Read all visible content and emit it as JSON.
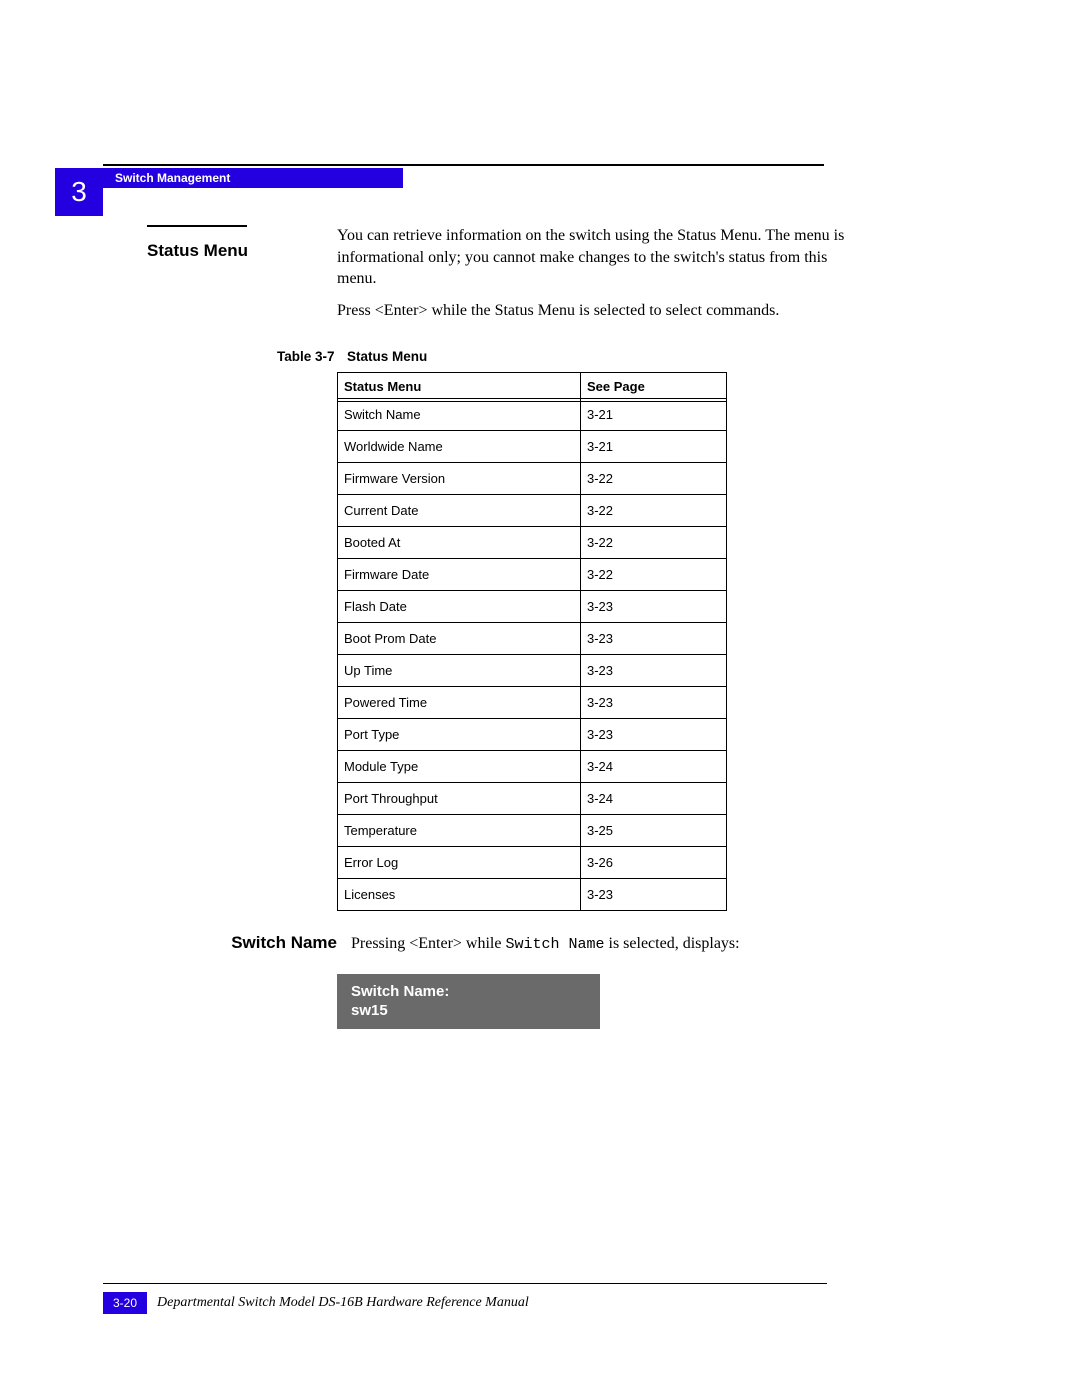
{
  "chapter_number": "3",
  "header_title": "Switch Management",
  "section": {
    "title": "Status Menu",
    "paragraph1": "You can retrieve information on the switch using the Status Menu. The menu is informational only; you cannot make changes to the switch's status from this menu.",
    "paragraph2": "Press <Enter> while the Status Menu is selected to select commands."
  },
  "table": {
    "caption_number": "Table 3-7",
    "caption_title": "Status Menu",
    "header_col1": "Status Menu",
    "header_col2": "See Page",
    "rows": [
      {
        "name": "Switch Name",
        "page": "3-21"
      },
      {
        "name": "Worldwide Name",
        "page": "3-21"
      },
      {
        "name": "Firmware Version",
        "page": "3-22"
      },
      {
        "name": "Current Date",
        "page": "3-22"
      },
      {
        "name": "Booted At",
        "page": "3-22"
      },
      {
        "name": "Firmware Date",
        "page": "3-22"
      },
      {
        "name": "Flash Date",
        "page": "3-23"
      },
      {
        "name": "Boot Prom Date",
        "page": "3-23"
      },
      {
        "name": "Up Time",
        "page": "3-23"
      },
      {
        "name": "Powered Time",
        "page": "3-23"
      },
      {
        "name": "Port Type",
        "page": "3-23"
      },
      {
        "name": "Module Type",
        "page": "3-24"
      },
      {
        "name": "Port Throughput",
        "page": "3-24"
      },
      {
        "name": "Temperature",
        "page": "3-25"
      },
      {
        "name": "Error Log",
        "page": "3-26"
      },
      {
        "name": "Licenses",
        "page": "3-23"
      }
    ]
  },
  "subsection": {
    "title": "Switch Name",
    "text_prefix": "Pressing <Enter> while ",
    "text_code": "Switch Name",
    "text_suffix": " is selected, displays:",
    "display_line1": "Switch Name:",
    "display_line2": "sw15"
  },
  "footer": {
    "page_number": "3-20",
    "manual_title": "Departmental Switch Model DS-16B Hardware Reference Manual"
  }
}
